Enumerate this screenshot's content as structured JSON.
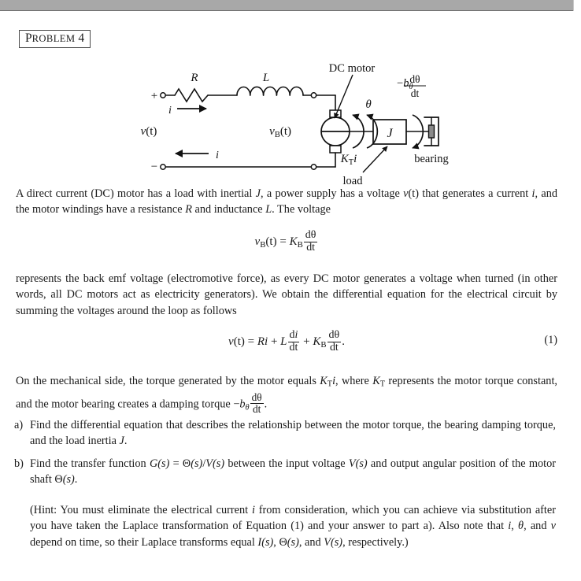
{
  "viewer": {
    "topbar_color": "#a8a8a8",
    "page_background": "#ffffff"
  },
  "problem": {
    "label_first": "P",
    "label_rest": "ROBLEM",
    "number": "4"
  },
  "figure": {
    "caption_dc_motor": "DC motor",
    "caption_bearing": "bearing",
    "caption_load": "load",
    "label_R": "R",
    "label_L": "L",
    "label_i_top": "i",
    "label_i_bottom": "i",
    "label_v_t": "v(t)",
    "label_plus": "+",
    "label_minus": "−",
    "label_vB": "v",
    "label_vB_sub": "B",
    "label_vB_arg": "(t)",
    "label_theta": "θ",
    "label_J": "J",
    "label_KT": "K",
    "label_KT_sub": "T",
    "label_KT_i": "i",
    "label_damping_minus": "−",
    "label_damping_b": "b",
    "label_damping_sub": "θ",
    "label_damping_num": "dθ",
    "label_damping_den": "dt"
  },
  "body": {
    "para1_a": "A direct current (DC) motor has a load with inertial ",
    "para1_J": "J",
    "para1_b": ", a power supply has a voltage ",
    "para1_v": "v",
    "para1_vt": "(t)",
    "para1_c": " that generates a current ",
    "para1_i": "i",
    "para1_d": ", and the motor windings have a resistance ",
    "para1_R": "R",
    "para1_e": " and inductance ",
    "para1_L": "L",
    "para1_f": ". The voltage",
    "eq_backemf_lhs_v": "v",
    "eq_backemf_lhs_sub": "B",
    "eq_backemf_lhs_arg": "(t)",
    "eq_backemf_eq": "=",
    "eq_backemf_K": "K",
    "eq_backemf_K_sub": "B",
    "eq_backemf_num": "dθ",
    "eq_backemf_den": "dt",
    "para2": "represents the back emf voltage (electromotive force), as every DC motor generates a voltage when turned (in other words, all DC motors act as electricity generators). We obtain the differential equation for the electrical circuit by summing the voltages around the loop as follows",
    "eq1_v": "v",
    "eq1_vt": "(t)",
    "eq1_eq": "=",
    "eq1_R": "R",
    "eq1_i": "i",
    "eq1_plus1": "+",
    "eq1_L": "L",
    "eq1_num1": "di",
    "eq1_den1": "dt",
    "eq1_plus2": "+",
    "eq1_K": "K",
    "eq1_K_sub": "B",
    "eq1_num2": "dθ",
    "eq1_den2": "dt",
    "eq1_period": ".",
    "eq1_number": "(1)",
    "para3_a": "On the mechanical side, the torque generated by the motor equals ",
    "para3_K": "K",
    "para3_K_sub": "T",
    "para3_i": "i",
    "para3_b": ", where ",
    "para3_K2": "K",
    "para3_K2_sub": "T",
    "para3_c": " represents the motor torque constant, and the motor bearing creates a damping torque ",
    "para3_minus": "−",
    "para3_b_sym": "b",
    "para3_b_sub": "θ",
    "para3_num": "dθ",
    "para3_den": "dt",
    "para3_end": ".",
    "item_a_marker": "a)",
    "item_a_text_a": "Find the differential equation that describes the relationship between the motor torque, the bearing damping torque, and the load inertia ",
    "item_a_J": "J",
    "item_a_end": ".",
    "item_b_marker": "b)",
    "item_b_a": "Find the transfer function ",
    "item_b_G": "G",
    "item_b_Gs": "(s)",
    "item_b_eq": " = ",
    "item_b_Theta": "Θ",
    "item_b_Ts": "(s)",
    "item_b_slash": "/",
    "item_b_V": "V",
    "item_b_Vs": "(s)",
    "item_b_b": " between the input voltage ",
    "item_b_V2": "V",
    "item_b_V2s": "(s)",
    "item_b_c": " and output angular position of the motor shaft ",
    "item_b_Theta2": "Θ",
    "item_b_T2s": "(s)",
    "item_b_end": ".",
    "hint_a": "(Hint: You must eliminate the electrical current ",
    "hint_i": "i",
    "hint_b": " from consideration, which you can achieve via substitution after you have taken the Laplace transformation of Equation (1) and your answer to part a). Also note that ",
    "hint_i2": "i",
    "hint_c": ", ",
    "hint_theta": "θ",
    "hint_d": ", and ",
    "hint_v": "v",
    "hint_e": " depend on time, so their Laplace transforms equal ",
    "hint_I": "I",
    "hint_Is": "(s)",
    "hint_f": ", ",
    "hint_Theta": "Θ",
    "hint_Ts": "(s)",
    "hint_g": ", and ",
    "hint_V": "V",
    "hint_Vs": "(s)",
    "hint_h": ", respectively.)"
  }
}
